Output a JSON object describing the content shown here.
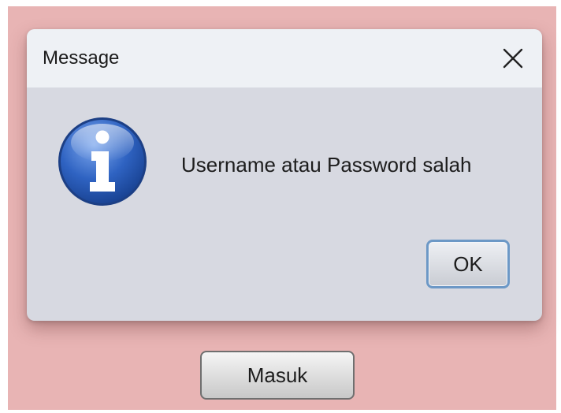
{
  "dialog": {
    "title": "Message",
    "message": "Username atau Password salah",
    "icon": "info-icon",
    "close_icon": "close-icon",
    "ok_label": "OK"
  },
  "background_window": {
    "masuk_label": "Masuk"
  },
  "colors": {
    "backdrop": "#e8b4b4",
    "dialog_body": "#d7d9e1",
    "titlebar": "#eef1f5",
    "ok_border": "#6c98c6",
    "info_icon_blue": "#2a5db7"
  }
}
